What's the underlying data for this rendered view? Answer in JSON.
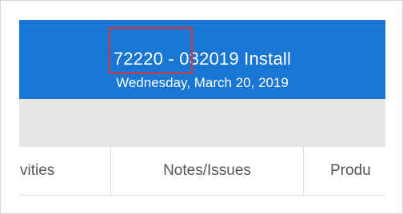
{
  "header": {
    "job_number": "72220",
    "title_suffix": " - 032019 Install",
    "date": "Wednesday, March 20, 2019"
  },
  "tabs": [
    {
      "label": "ctivities"
    },
    {
      "label": "Notes/Issues"
    },
    {
      "label": "Produ"
    }
  ],
  "colors": {
    "header_bg": "#1976d2",
    "highlight_border": "#d6333a",
    "band_bg": "#e6e6e6"
  }
}
